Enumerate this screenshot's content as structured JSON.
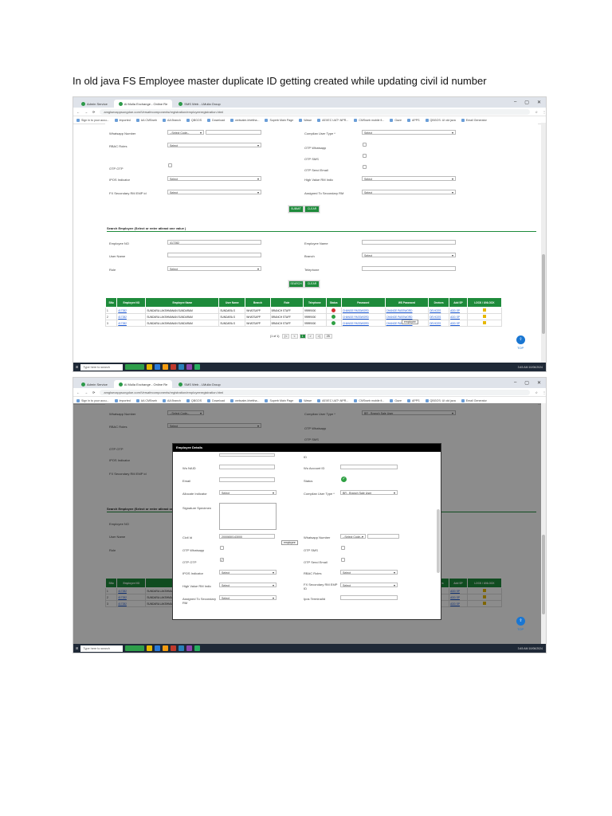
{
  "doc": {
    "title": "In old java FS Employee master duplicate ID getting created while updating civil id number"
  },
  "browser": {
    "tabs": [
      "Admin Service",
      "Al Mulla Exchange - Online Re",
      "SMS Web - LMulla Group"
    ],
    "url": "amglsexappsungdoe.com/Versafecomponents/registration/employeeregistration.html",
    "bookmarks": [
      "Sign in to your accu...",
      "Imported",
      "AA CMSweb",
      "AA Branch",
      "QBGOS",
      "Download",
      "webcalm-bhettha...",
      "Superb Main Page",
      "Wawe",
      "AEXEC UAT*-NPR...",
      "CMSweb mobile fi...",
      "Gaze",
      "APPS",
      "QBGOS: UI old java",
      "Email Generator",
      "All Bookmarks"
    ]
  },
  "form": {
    "whatsapp_label": "Whatsapp Number",
    "whatsapp_code": "--Select Code--",
    "rbac_label": "RBAC Roles",
    "select": "Select",
    "otp_label": "OTP OTP",
    "ipos_label": "IPOS Indicator",
    "rm_emp_label": "FX Secondary RM EMP id",
    "complian_label": "Complian User Type *",
    "complian_value2": "BR - Branch Sale User",
    "otp_whatsapp": "OTP Whatsapp",
    "otp_sms": "OTP SMS",
    "otp_send_email": "OTP Send Email",
    "hv_label": "High Value RM Indic",
    "assigned_label": "Assigned To Secondary RM",
    "submit": "SUBMIT",
    "clear": "CLEAR"
  },
  "search": {
    "heading": "Search Employee (Select or enter atleast one value )",
    "emp_no_label": "Employee NO",
    "emp_no_value": "417282",
    "username_label": "User Name",
    "role_label": "Role",
    "emp_name_label": "Employee Name",
    "branch_label": "Branch",
    "telephone_label": "Telephone",
    "search_btn": "SEARCH",
    "clear_btn": "CLEAR"
  },
  "grid": {
    "headers": [
      "SNo",
      "Employee NO",
      "Employee Name",
      "User Name",
      "Branch",
      "Role",
      "Telephone",
      "Status",
      "Password",
      "WS Password",
      "Devices",
      "Add SP",
      "LOCK / UNLOCK"
    ],
    "rows": [
      {
        "sno": "1",
        "emp": "417282",
        "name": "SUNDARA LAKSHMANAN SUNDARAM",
        "user": "SUNDARA.S",
        "branch": "WHATSAPP",
        "role": "BRANCH STAFF",
        "tel": "99999000",
        "status": "x",
        "pw": "CHANGE PASSWORD",
        "ws": "CHANGE PASSWORD",
        "dev": "DEVICES",
        "sp": "ADD SP"
      },
      {
        "sno": "2",
        "emp": "417282",
        "name": "SUNDARA LAKSHMANAN SUNDARAM",
        "user": "SUNDARA.S",
        "branch": "WHATSAPP",
        "role": "BRANCH STAFF",
        "tel": "99999000",
        "status": "ok",
        "pw": "CHANGE PASSWORD",
        "ws": "CHANGE PASSWORD",
        "dev": "DEVICES",
        "sp": "ADD SP"
      },
      {
        "sno": "3",
        "emp": "417282",
        "name": "SUNDARA LAKSHMANAN SUNDARAM",
        "user": "SUNDARA.S",
        "branch": "WHATSAPP",
        "role": "BRANCH STAFF",
        "tel": "99999000",
        "status": "ok",
        "pw": "CHANGE PASSWORD",
        "ws": "CHANGE PASSWORD",
        "dev": "DEVICES",
        "sp": "ADD SP"
      }
    ],
    "pager": "(1 of 1)",
    "page_size": "25",
    "tooltip": "employee"
  },
  "modal": {
    "title": "Employee Details",
    "wu_naid": "Wu NAID",
    "email": "Email",
    "allocate": "Allocate Indicator",
    "signature": "Signature Specimen",
    "civil_id": "Civil Id",
    "civil_value": "2000650143000",
    "otp_whatsapp": "OTP Whatsapp",
    "otp_otp": "OTP OTP",
    "ipos": "IPOS Indicator",
    "hv": "High Value RM Indic",
    "assigned": "Assigned To Secondary RM",
    "wu_account": "Wu Account ID",
    "status": "Status",
    "complian": "Complian User Type *",
    "complian_value": "BR - Branch Sale User",
    "whatsapp": "Whatsapp Number",
    "whatsapp_code": "--Select Code--",
    "otp_sms": "OTP SMS",
    "otp_send_email": "OTP Send Email",
    "rbac": "RBAC Roles",
    "fx_rm": "FX Secondary RM EMP ID",
    "ipos_terminal": "Ipos TerminalId",
    "cut_label": "ID",
    "tooltip": "employee"
  },
  "taskbar": {
    "search": "Type here to search",
    "time": "3:45 AM",
    "date": "10/06/2024"
  },
  "top_label": "TOP"
}
